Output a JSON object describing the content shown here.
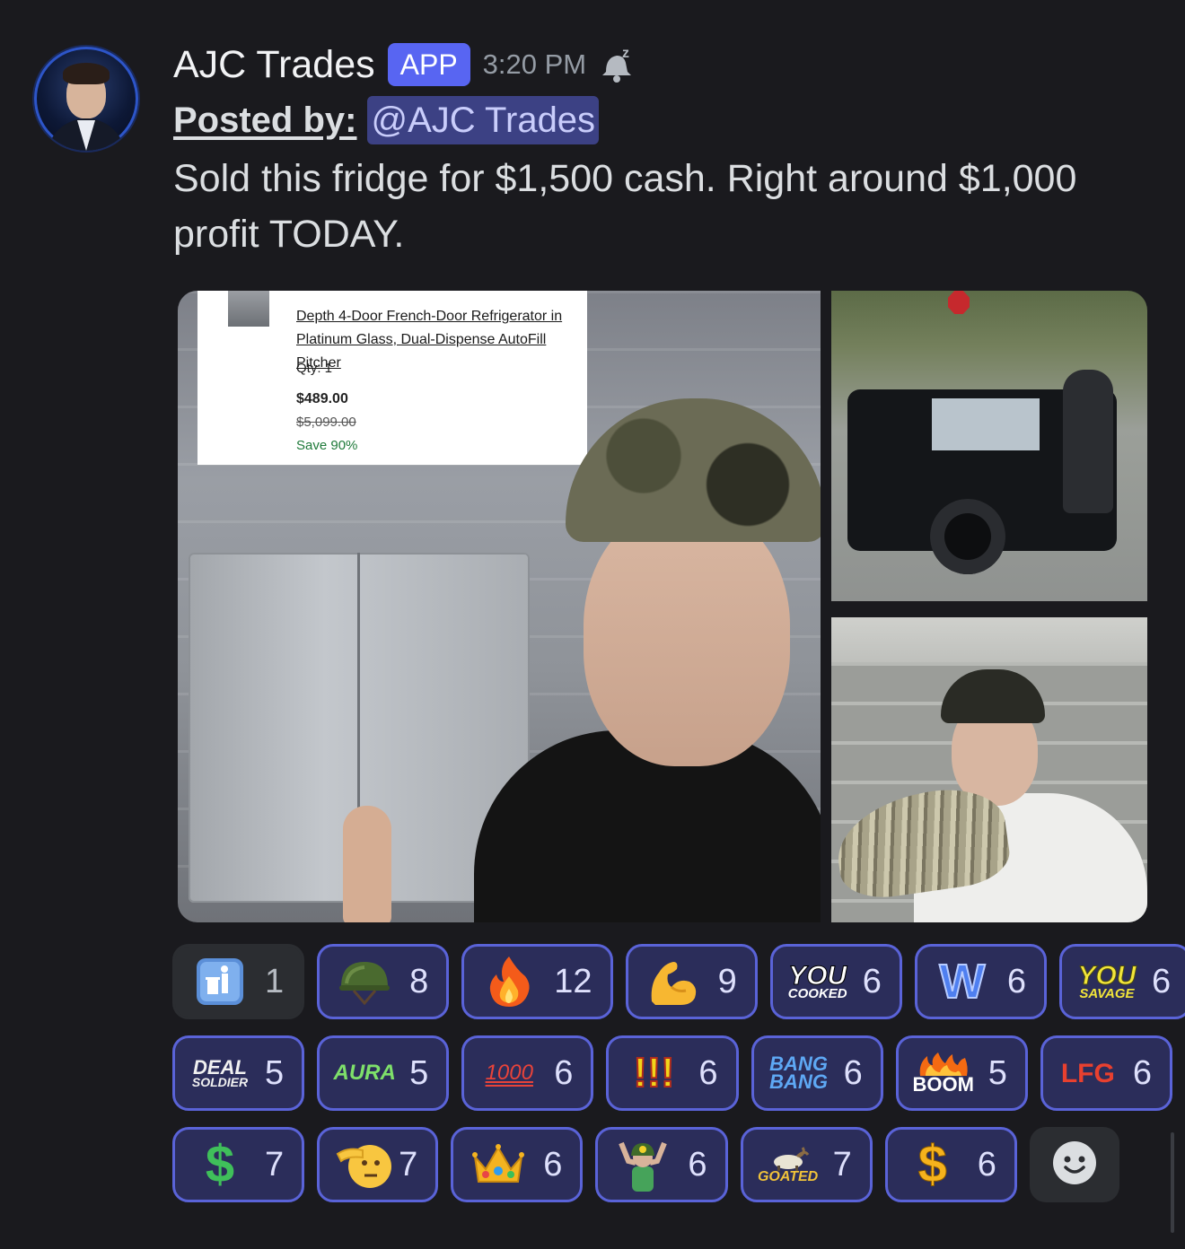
{
  "message": {
    "username": "AJC Trades",
    "badge": "APP",
    "timestamp": "3:20 PM",
    "posted_by_label": "Posted by:",
    "mention": "@AJC Trades",
    "text": "Sold this fridge for $1,500 cash. Right around $1,000 profit TODAY."
  },
  "receipt": {
    "product_name": "Depth 4-Door French-Door Refrigerator in Platinum Glass, Dual-Dispense AutoFill Pitcher",
    "qty": "Qty: 1",
    "price": "$489.00",
    "original_price": "$5,099.00",
    "savings": "Save 90%"
  },
  "reactions": [
    [
      {
        "icon": "trash-can-sign-icon",
        "count": "1",
        "selected": false
      },
      {
        "icon": "army-helmet-icon",
        "count": "8",
        "selected": true
      },
      {
        "icon": "fire-icon",
        "count": "12",
        "selected": true
      },
      {
        "icon": "flexed-biceps-icon",
        "count": "9",
        "selected": true
      },
      {
        "icon": "you-cooked-sticker-icon",
        "label_top": "YOU",
        "label_bottom": "COOKED",
        "count": "6",
        "selected": true
      },
      {
        "icon": "w-letter-icon",
        "label": "W",
        "count": "6",
        "selected": true
      },
      {
        "icon": "you-savage-sticker-icon",
        "label_top": "YOU",
        "label_bottom": "SAVAGE",
        "count": "6",
        "selected": true
      }
    ],
    [
      {
        "icon": "deal-soldier-logo-icon",
        "label_top": "DEAL",
        "label_bottom": "SOLDIER",
        "count": "5",
        "selected": true
      },
      {
        "icon": "aura-text-icon",
        "label": "AURA",
        "count": "5",
        "selected": true
      },
      {
        "icon": "hundred-points-icon",
        "label": "1000",
        "count": "6",
        "selected": true
      },
      {
        "icon": "triple-exclamation-icon",
        "label": "!!!",
        "count": "6",
        "selected": true
      },
      {
        "icon": "bang-bang-text-icon",
        "label_top": "BANG",
        "label_bottom": "BANG",
        "count": "6",
        "selected": true
      },
      {
        "icon": "boom-fire-text-icon",
        "label": "BOOM",
        "count": "5",
        "selected": true
      },
      {
        "icon": "lfg-text-icon",
        "label": "LFG",
        "count": "6",
        "selected": true
      }
    ],
    [
      {
        "icon": "green-dollar-sign-icon",
        "label": "$",
        "count": "7",
        "selected": true
      },
      {
        "icon": "saluting-face-icon",
        "count": "7",
        "selected": true
      },
      {
        "icon": "crown-icon",
        "count": "6",
        "selected": true
      },
      {
        "icon": "cheering-soldier-icon",
        "count": "6",
        "selected": true
      },
      {
        "icon": "goated-goat-icon",
        "label": "GOATED",
        "count": "7",
        "selected": true
      },
      {
        "icon": "gold-dollar-sign-icon",
        "label": "$",
        "count": "6",
        "selected": true
      }
    ]
  ],
  "colors": {
    "background": "#1a1a1e",
    "accent": "#5865f2",
    "mention_bg": "#3c4184",
    "reaction_selected_bg": "#2b2d5a",
    "reaction_selected_border": "#5a63d8"
  }
}
